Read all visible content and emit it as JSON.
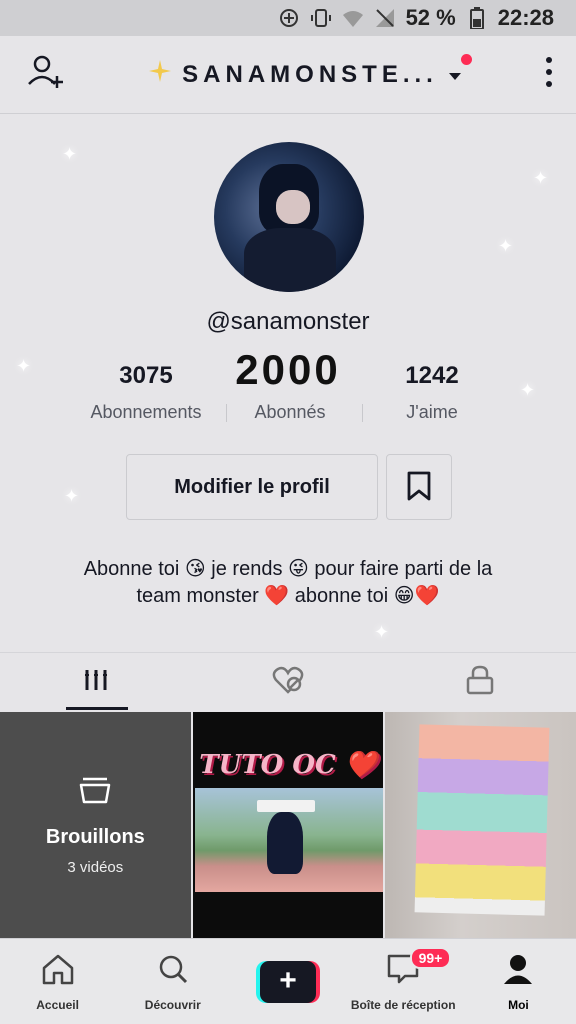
{
  "status_bar": {
    "battery_text": "52 %",
    "time": "22:28",
    "icons": [
      "sync-icon",
      "vibrate-icon",
      "wifi-icon",
      "no-signal-icon",
      "battery-icon"
    ]
  },
  "header": {
    "username": "SANAMONSTE...",
    "icons": [
      "add-user-icon",
      "sparkle-icon",
      "dropdown-icon",
      "more-options-icon"
    ]
  },
  "profile": {
    "handle": "@sanamonster",
    "overlay_number": "2000",
    "stats": [
      {
        "value": "3075",
        "label": "Abonnements"
      },
      {
        "value": "",
        "label": "Abonnés"
      },
      {
        "value": "1242",
        "label": "J'aime"
      }
    ],
    "edit_button": "Modifier le profil",
    "bio_line1": "Abonne toi 😘 je rends 😜 pour faire parti de la",
    "bio_line2": "team monster ❤️ abonne toi 😁❤️"
  },
  "tabs": [
    {
      "icon": "videos-grid-icon",
      "active": true
    },
    {
      "icon": "liked-heart-icon",
      "active": false
    },
    {
      "icon": "private-lock-icon",
      "active": false
    }
  ],
  "grid": {
    "drafts_title": "Brouillons",
    "drafts_count": "3 vidéos",
    "video2_title": "TUTO OC ❤️"
  },
  "bottom_nav": [
    {
      "label": "Accueil",
      "icon": "home-icon"
    },
    {
      "label": "Découvrir",
      "icon": "search-icon"
    },
    {
      "label": "",
      "icon": "plus-icon"
    },
    {
      "label": "Boîte de réception",
      "icon": "inbox-icon",
      "badge": "99+"
    },
    {
      "label": "Moi",
      "icon": "profile-icon"
    }
  ],
  "colors": {
    "accent": "#fe2c55",
    "accent_secondary": "#25f4ee",
    "text": "#161823",
    "background": "#e6e5e8"
  }
}
